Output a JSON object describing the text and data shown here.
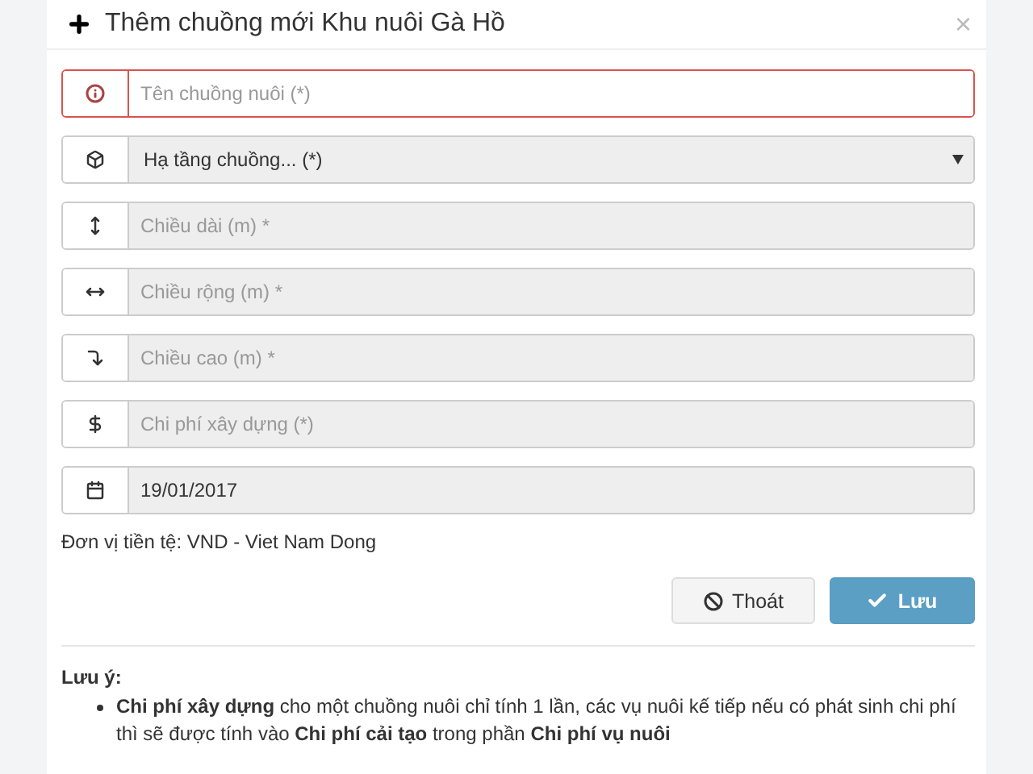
{
  "dialog": {
    "title": "Thêm chuồng mới Khu nuôi Gà Hồ",
    "close": "×"
  },
  "fields": [
    {
      "kind": "input",
      "placeholder": "Tên chuồng nuôi (*)",
      "error": true,
      "disabled": false
    },
    {
      "kind": "select",
      "value": "Hạ tầng chuồng... (*)",
      "error": false,
      "disabled": true
    },
    {
      "kind": "input",
      "placeholder": "Chiều dài (m) *",
      "error": false,
      "disabled": true
    },
    {
      "kind": "input",
      "placeholder": "Chiều rộng (m) *",
      "error": false,
      "disabled": true
    },
    {
      "kind": "input",
      "placeholder": "Chiều cao (m) *",
      "error": false,
      "disabled": true
    },
    {
      "kind": "input",
      "placeholder": "Chi phí xây dựng (*)",
      "error": false,
      "disabled": true
    },
    {
      "kind": "input",
      "value": "19/01/2017",
      "error": false,
      "disabled": true
    }
  ],
  "currency_note": "Đơn vị tiền tệ: VND - Viet Nam Dong",
  "buttons": [
    {
      "kind": "cancel",
      "label": "Thoát"
    },
    {
      "kind": "save",
      "label": "Lưu"
    }
  ],
  "note": {
    "title": "Lưu ý:",
    "items": [
      "**Chi phí xây dựng** cho một chuồng nuôi chỉ tính 1 lần, các vụ nuôi kế tiếp nếu có phát sinh chi phí thì sẽ được tính vào **Chi phí cải tạo** trong phần **Chi phí vụ nuôi**"
    ]
  }
}
